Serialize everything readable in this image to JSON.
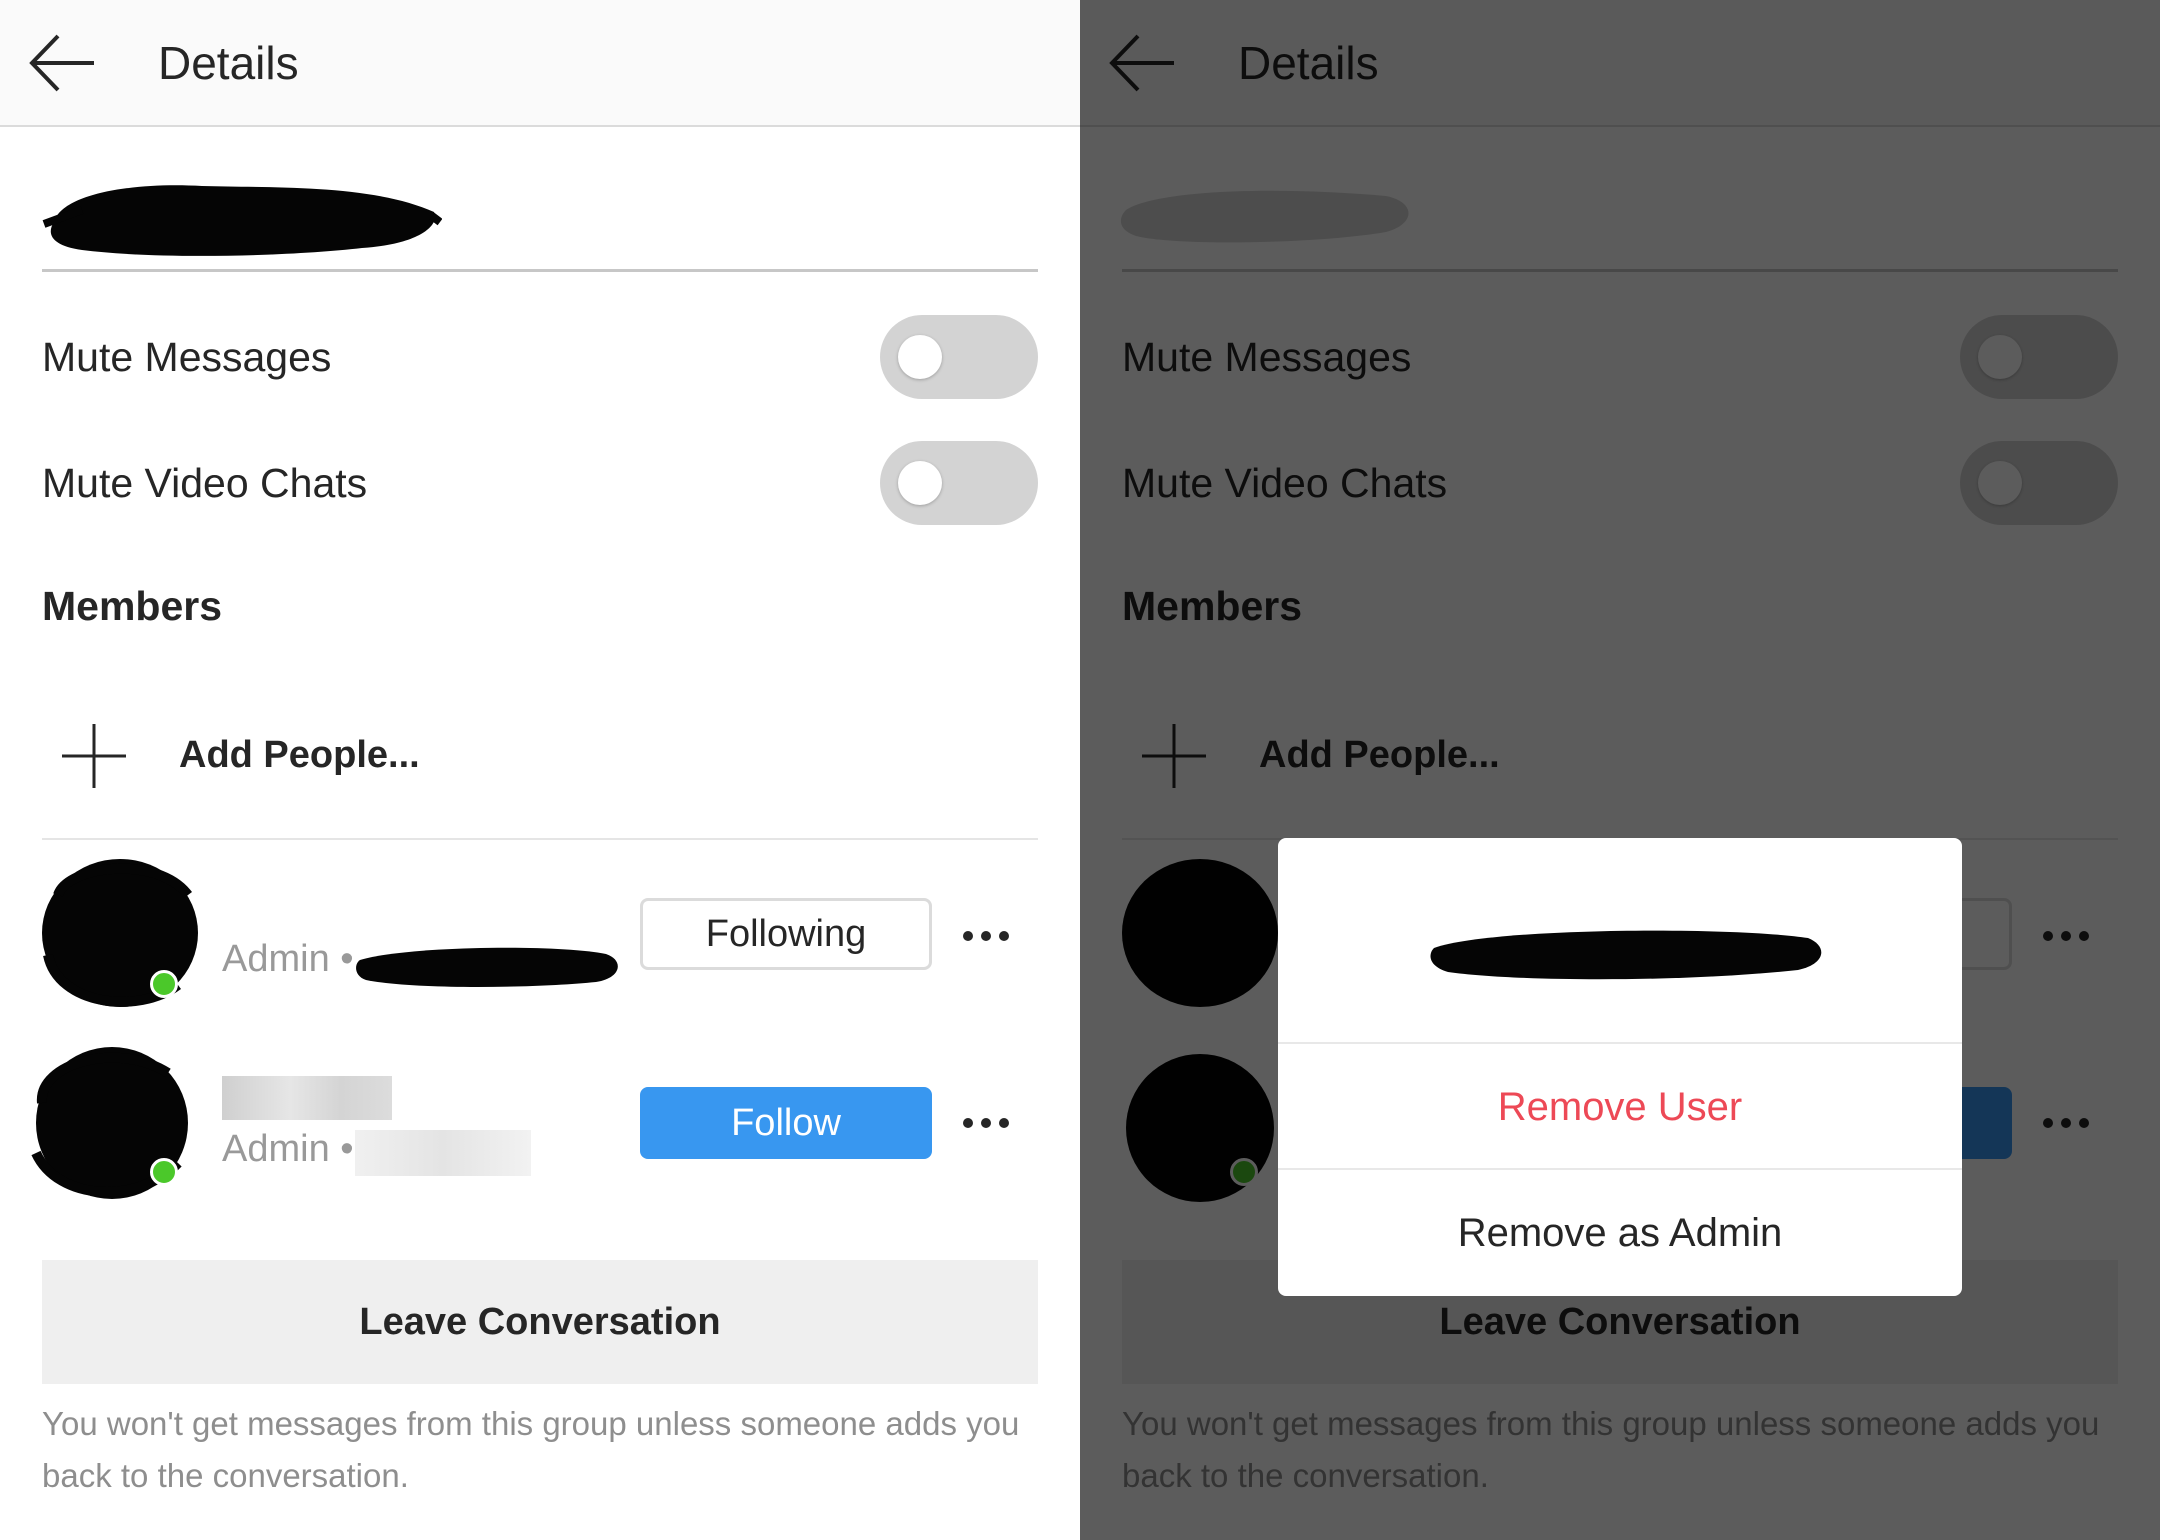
{
  "header": {
    "title": "Details"
  },
  "settings": {
    "mute_messages": {
      "label": "Mute Messages",
      "on": false
    },
    "mute_video_chats": {
      "label": "Mute Video Chats",
      "on": false
    }
  },
  "members": {
    "title": "Members",
    "add_label": "Add People...",
    "list": [
      {
        "role_text": "Admin •",
        "action_label": "Following",
        "online": true
      },
      {
        "role_text": "Admin •",
        "action_label": "Follow",
        "online": true
      }
    ]
  },
  "leave": {
    "label": "Leave Conversation",
    "note": "You won't get messages from this group unless someone adds you back to the conversation."
  },
  "dialog": {
    "items": [
      {
        "label": "Remove User",
        "style": "danger"
      },
      {
        "label": "Remove as Admin",
        "style": "normal"
      }
    ]
  },
  "colors": {
    "follow_blue": "#3897f0",
    "danger_red": "#ed4956",
    "online_green": "#4bc82a",
    "toggle_off": "#d3d3d3"
  },
  "icons": [
    "back-arrow-icon",
    "plus-icon",
    "more-dots-icon"
  ]
}
